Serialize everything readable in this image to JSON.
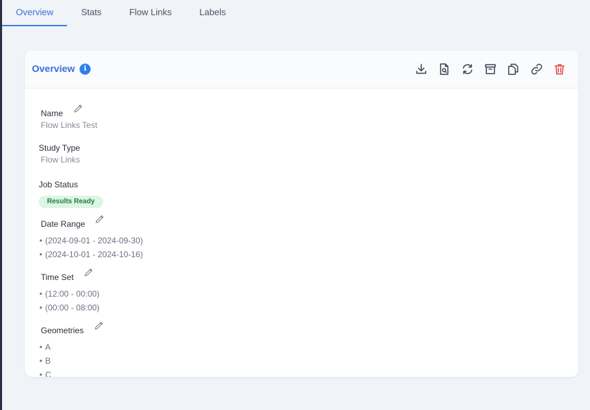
{
  "tabs": [
    "Overview",
    "Stats",
    "Flow Links",
    "Labels"
  ],
  "active_tab": "Overview",
  "card": {
    "title": "Overview",
    "info_icon": "i",
    "toolbar_icons": [
      "download-icon",
      "file-search-icon",
      "refresh-icon",
      "archive-icon",
      "copy-icon",
      "link-icon",
      "trash-icon"
    ]
  },
  "fields": {
    "name": {
      "label": "Name",
      "value": "Flow Links Test"
    },
    "study_type": {
      "label": "Study Type",
      "value": "Flow Links"
    },
    "job_status": {
      "label": "Job Status",
      "value": "Results Ready"
    },
    "date_range": {
      "label": "Date Range",
      "items": [
        "(2024-09-01 - 2024-09-30)",
        "(2024-10-01 - 2024-10-16)"
      ]
    },
    "time_set": {
      "label": "Time Set",
      "items": [
        "(12:00 - 00:00)",
        "(00:00 - 08:00)"
      ]
    },
    "geometries": {
      "label": "Geometries",
      "items": [
        "A",
        "B",
        "C"
      ]
    }
  },
  "colors": {
    "accent": "#3a6fd8",
    "danger": "#e04545",
    "success_bg": "#dcf5e4",
    "success_text": "#237a45"
  }
}
